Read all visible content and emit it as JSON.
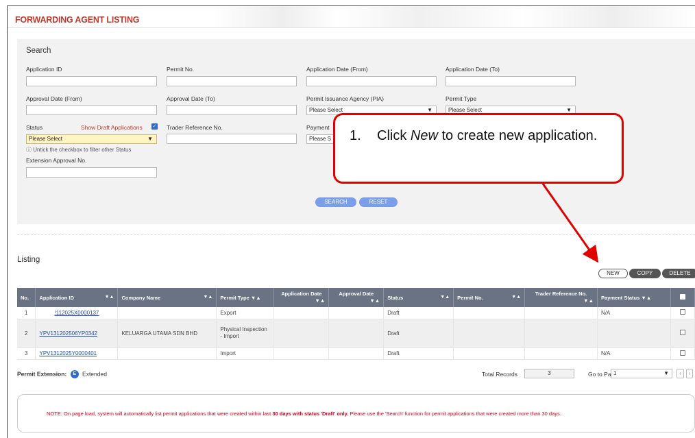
{
  "page": {
    "title": "FORWARDING AGENT LISTING"
  },
  "search": {
    "heading": "Search",
    "application_id_label": "Application ID",
    "permit_no_label": "Permit No.",
    "application_date_from_label": "Application Date (From)",
    "application_date_to_label": "Application Date (To)",
    "approval_date_from_label": "Approval Date (From)",
    "approval_date_to_label": "Approval Date (To)",
    "pia_label": "Permit Issuance Agency (PIA)",
    "pia_value": "Please Select",
    "permit_type_label": "Permit Type",
    "permit_type_value": "Please Select",
    "status_label": "Status",
    "status_value": "Please Select",
    "show_draft_label": "Show Draft Applications",
    "show_draft_checked": "✓",
    "trader_ref_label": "Trader Reference No.",
    "payment_label": "Payment",
    "payment_value": "Please S",
    "untick_hint": "Untick the checkbox to filter other Status",
    "extension_label": "Extension Approval No.",
    "search_button": "SEARCH",
    "reset_button": "RESET"
  },
  "callout": {
    "number": "1.",
    "text_before": "Click ",
    "text_em": "New",
    "text_after": " to create new application."
  },
  "listing": {
    "heading": "Listing",
    "new_button": "NEW",
    "copy_button": "COPY",
    "delete_button": "DELETE",
    "sort_glyph": "▼▲",
    "columns": [
      "No.",
      "Application ID",
      "Company Name",
      "Permit Type",
      "Application Date",
      "Approval Date",
      "Status",
      "Permit No.",
      "Trader Reference No.",
      "Payment Status"
    ],
    "rows": [
      {
        "no": "1",
        "app_id": "!112025X0000137",
        "company": "",
        "permit_type": "Export",
        "app_date": "",
        "approval_date": "",
        "status": "Draft",
        "permit_no": "",
        "trader_ref": "",
        "payment": "N/A"
      },
      {
        "no": "2",
        "app_id": "YPV131202506YP0342",
        "company": "KELUARGA UTAMA SDN BHD",
        "permit_type": "Physical Inspection - Import",
        "app_date": "",
        "approval_date": "",
        "status": "Draft",
        "permit_no": "",
        "trader_ref": "",
        "payment": ""
      },
      {
        "no": "3",
        "app_id": "YPV1312025Y0000401",
        "company": "",
        "permit_type": "Import",
        "app_date": "",
        "approval_date": "",
        "status": "Draft",
        "permit_no": "",
        "trader_ref": "",
        "payment": "N/A"
      }
    ]
  },
  "footer": {
    "permit_extension_label": "Permit Extension:",
    "extended_badge": "E",
    "extended_label": "Extended",
    "total_records_label": "Total Records",
    "total_records_value": "3",
    "go_to_page_label": "Go to Page",
    "go_to_page_value": "1",
    "prev_glyph": "‹",
    "next_glyph": "›"
  },
  "note": {
    "prefix": "NOTE: On page load, system will automatically list permit applications that were created within last ",
    "bold": "30 days with status 'Draft' only.",
    "suffix": " Please use the 'Search' function for permit applications that were created more than 30 days."
  },
  "colors": {
    "title_red": "#c0392b",
    "callout_red": "#e00000",
    "header_grey": "#6a7384",
    "button_blue": "#7b9ee8",
    "link_blue": "#1f4fa8"
  }
}
